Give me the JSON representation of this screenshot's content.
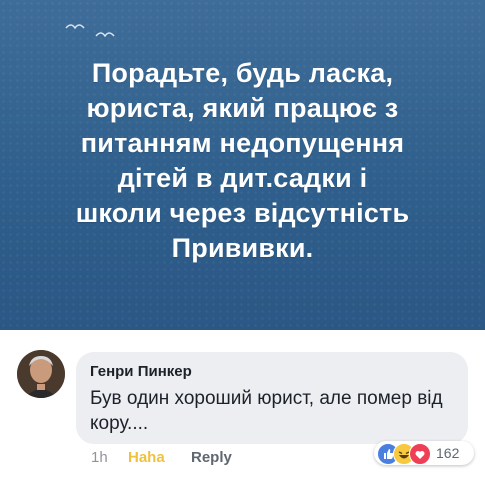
{
  "post": {
    "lines": [
      "Порадьте, будь ласка,",
      "юриста, який працює з",
      "питанням недопущення",
      "дітей в дит.садки і",
      "школи через відсутність",
      "Прививки."
    ],
    "background_color": "#2f5f8c",
    "text_color": "#ffffff"
  },
  "comment": {
    "author": "Генри Пинкер",
    "text": "Був один хороший юрист, але помер від кору....",
    "bubble_color": "#eceef2"
  },
  "actions": {
    "time": "1h",
    "reaction_label": "Haha",
    "reply_label": "Reply"
  },
  "reactions": {
    "icons": [
      "like-icon",
      "haha-icon",
      "love-icon"
    ],
    "count": "162"
  }
}
